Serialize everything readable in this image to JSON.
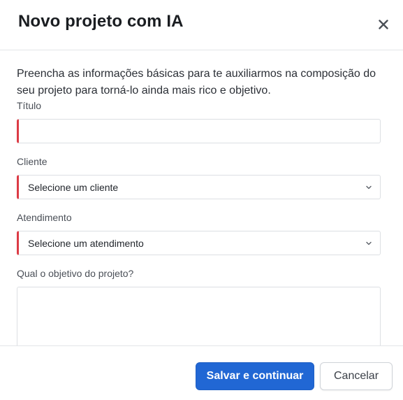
{
  "dialog": {
    "title": "Novo projeto com IA",
    "close_icon": "close-icon"
  },
  "form": {
    "intro": "Preencha as informações básicas para te auxiliarmos na composição do seu projeto para torná-lo ainda mais rico e objetivo.",
    "titulo": {
      "label": "Título",
      "value": "",
      "placeholder": ""
    },
    "cliente": {
      "label": "Cliente",
      "selected": "Selecione um cliente"
    },
    "atendimento": {
      "label": "Atendimento",
      "selected": "Selecione um atendimento"
    },
    "objetivo": {
      "label": "Qual o objetivo do projeto?",
      "value": ""
    }
  },
  "footer": {
    "save_label": "Salvar e continuar",
    "cancel_label": "Cancelar"
  },
  "colors": {
    "primary": "#2167d4",
    "required_marker": "#dc3b45",
    "border": "#dcdfe3"
  }
}
